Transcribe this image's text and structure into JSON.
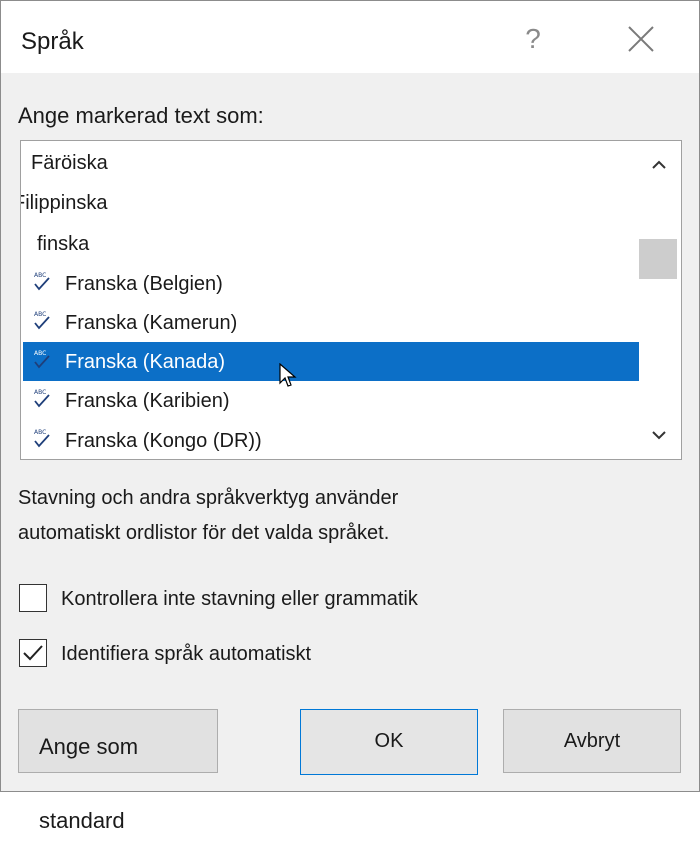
{
  "dialog": {
    "title": "Språk",
    "help_label": "?",
    "prompt_label": "Ange markerad text som:",
    "languages": [
      {
        "label": "Färöiska",
        "spell_icon": false,
        "selected": false
      },
      {
        "label": "Filippinska",
        "spell_icon": false,
        "selected": false
      },
      {
        "label": "finska",
        "spell_icon": false,
        "selected": false
      },
      {
        "label": "Franska (Belgien)",
        "spell_icon": true,
        "selected": false
      },
      {
        "label": "Franska (Kamerun)",
        "spell_icon": true,
        "selected": false
      },
      {
        "label": "Franska (Kanada)",
        "spell_icon": true,
        "selected": true
      },
      {
        "label": "Franska (Karibien)",
        "spell_icon": true,
        "selected": false
      },
      {
        "label": "Franska (Kongo (DR))",
        "spell_icon": true,
        "selected": false
      }
    ],
    "info_text_line1": "Stavning och andra språkverktyg använder",
    "info_text_line2": "automatiskt ordlistor för det valda språket.",
    "checkbox_no_spellcheck": {
      "label": "Kontrollera inte stavning eller grammatik",
      "checked": false
    },
    "checkbox_detect_language": {
      "label": "Identifiera språk automatiskt",
      "checked": true
    },
    "buttons": {
      "set_default": "Ange som standard",
      "ok": "OK",
      "cancel": "Avbryt"
    }
  },
  "colors": {
    "selection": "#0c6fc7",
    "dialog_background": "#f0f0f0",
    "default_button_border": "#0078d7",
    "spell_icon": "#1f3f7a"
  },
  "icons": {
    "close": "close-icon",
    "help": "help-icon",
    "spell": "spell-check-icon",
    "scroll_up": "chevron-up-icon",
    "scroll_down": "chevron-down-icon",
    "checkmark": "checkmark-icon"
  }
}
